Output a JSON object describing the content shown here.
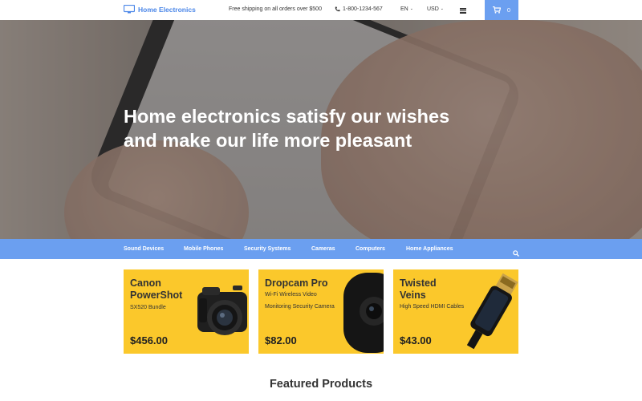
{
  "header": {
    "brand": "Home Electronics",
    "shipping": "Free shipping on all orders over $500",
    "phone": "1-800-1234-567",
    "language": "EN",
    "currency": "USD",
    "cart_count": "0",
    "accent_color": "#6b9ff0"
  },
  "hero": {
    "title_line1": "Home electronics satisfy our wishes",
    "title_line2": "and make our life more pleasant"
  },
  "categories": [
    "Sound Devices",
    "Mobile Phones",
    "Security Systems",
    "Cameras",
    "Computers",
    "Home Appliances"
  ],
  "products": [
    {
      "name_line1": "Canon",
      "name_line2": "PowerShot",
      "sub_line1": "SX520 Bundle",
      "sub_line2": "",
      "price": "$456.00",
      "icon": "camera-image"
    },
    {
      "name_line1": "Dropcam Pro",
      "name_line2": "",
      "sub_line1": "Wi-Fi Wireless Video",
      "sub_line2": "Monitoring Security Camera",
      "price": "$82.00",
      "icon": "security-camera-image"
    },
    {
      "name_line1": "Twisted",
      "name_line2": "Veins",
      "sub_line1": "High Speed HDMI Cables",
      "sub_line2": "",
      "price": "$43.00",
      "icon": "hdmi-cable-image"
    }
  ],
  "tile_color": "#fbc82b",
  "featured_title": "Featured Products"
}
